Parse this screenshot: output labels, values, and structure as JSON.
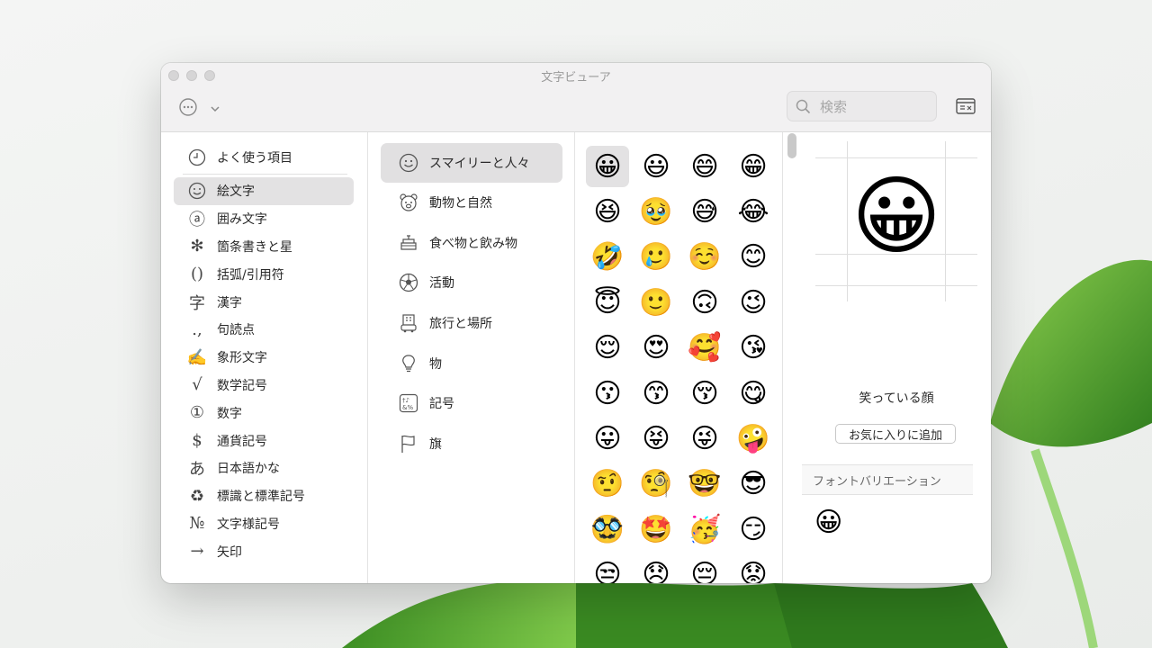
{
  "window": {
    "title": "文字ビューア"
  },
  "search": {
    "placeholder": "検索"
  },
  "favorites": {
    "label": "よく使う項目"
  },
  "categories": [
    {
      "label": "絵文字",
      "icon": "smiley-icon",
      "selected": true
    },
    {
      "label": "囲み文字",
      "icon": "circled-a-icon",
      "glyph": "ⓐ"
    },
    {
      "label": "箇条書きと星",
      "icon": "asterisk-icon",
      "glyph": "✻"
    },
    {
      "label": "括弧/引用符",
      "icon": "parentheses-icon",
      "glyph": "()"
    },
    {
      "label": "漢字",
      "icon": "kanji-icon",
      "glyph": "字"
    },
    {
      "label": "句読点",
      "icon": "punctuation-icon",
      "glyph": ".,"
    },
    {
      "label": "象形文字",
      "icon": "pictograph-icon",
      "glyph": "✍"
    },
    {
      "label": "数学記号",
      "icon": "square-root-icon",
      "glyph": "√"
    },
    {
      "label": "数字",
      "icon": "circled-one-icon",
      "glyph": "①"
    },
    {
      "label": "通貨記号",
      "icon": "dollar-icon",
      "glyph": "$"
    },
    {
      "label": "日本語かな",
      "icon": "hiragana-icon",
      "glyph": "あ"
    },
    {
      "label": "標識と標準記号",
      "icon": "recycle-icon",
      "glyph": "♻"
    },
    {
      "label": "文字様記号",
      "icon": "numero-icon",
      "glyph": "№"
    },
    {
      "label": "矢印",
      "icon": "arrow-icon",
      "glyph": "→"
    }
  ],
  "subcategories": [
    {
      "label": "スマイリーと人々",
      "icon": "smiley-icon",
      "selected": true
    },
    {
      "label": "動物と自然",
      "icon": "bear-icon"
    },
    {
      "label": "食べ物と飲み物",
      "icon": "food-icon"
    },
    {
      "label": "活動",
      "icon": "soccer-ball-icon"
    },
    {
      "label": "旅行と場所",
      "icon": "building-icon"
    },
    {
      "label": "物",
      "icon": "lightbulb-icon"
    },
    {
      "label": "記号",
      "icon": "symbols-icon"
    },
    {
      "label": "旗",
      "icon": "flag-icon"
    }
  ],
  "emojis": [
    "😀",
    "😃",
    "😄",
    "😁",
    "😆",
    "🥹",
    "😅",
    "😂",
    "🤣",
    "🥲",
    "☺️",
    "😊",
    "😇",
    "🙂",
    "🙃",
    "😉",
    "😌",
    "😍",
    "🥰",
    "😘",
    "😗",
    "😙",
    "😚",
    "😋",
    "😛",
    "😝",
    "😜",
    "🤪",
    "🤨",
    "🧐",
    "🤓",
    "😎",
    "🥸",
    "🤩",
    "🥳",
    "😏",
    "😒",
    "😞",
    "😔",
    "😟"
  ],
  "preview": {
    "emoji": "😀",
    "name": "笑っている顔",
    "add_favorite_label": "お気に入りに追加"
  },
  "font_variations": {
    "label": "フォントバリエーション",
    "items": [
      "😀"
    ]
  },
  "colors": {
    "selection": "#e3e2e3",
    "titlebar": "#f2f1f2"
  }
}
